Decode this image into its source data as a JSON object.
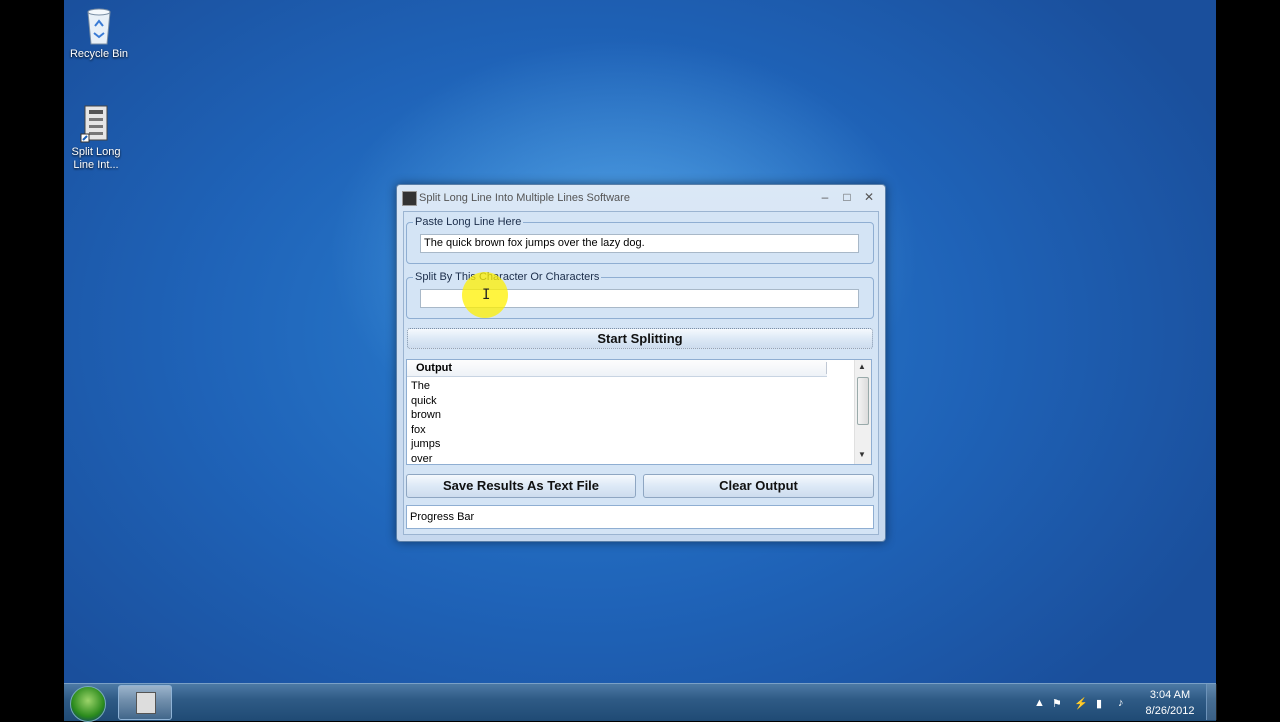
{
  "desktop": {
    "icons": [
      {
        "label": "Recycle Bin",
        "icon": "recycle-bin-icon"
      },
      {
        "label": "Split Long Line Int...",
        "icon": "app-shortcut-icon"
      }
    ]
  },
  "window": {
    "title": "Split Long Line Into Multiple Lines Software",
    "controls": {
      "minimize": "–",
      "maximize": "□",
      "close": "✕"
    },
    "input_group": {
      "label": "Paste Long Line Here",
      "value": "The quick brown fox jumps over the lazy dog."
    },
    "split_group": {
      "label": "Split By This Character Or Characters",
      "value": ""
    },
    "start_button": "Start Splitting",
    "output": {
      "header": "Output",
      "lines": [
        "The",
        "quick",
        "brown",
        "fox",
        "jumps",
        "over"
      ]
    },
    "save_button": "Save Results As Text File",
    "clear_button": "Clear Output",
    "progress_label": "Progress Bar"
  },
  "taskbar": {
    "clock_time": "3:04 AM",
    "clock_date": "8/26/2012",
    "tray_icons": [
      "show-hidden-icon",
      "flag-icon",
      "power-icon",
      "network-icon",
      "volume-icon"
    ]
  }
}
